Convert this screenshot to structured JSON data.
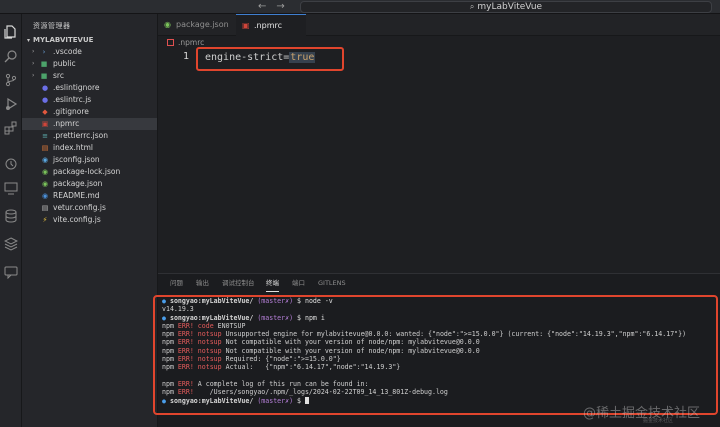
{
  "titlebar": {
    "back": "←",
    "forward": "→",
    "search_text": "myLabViteVue"
  },
  "activity": [
    "files-icon",
    "search-icon",
    "source-control-icon",
    "run-debug-icon",
    "extensions-icon",
    "git-history-icon",
    "remote-icon",
    "database-icon",
    "layers-icon",
    "chat-icon"
  ],
  "sidebar": {
    "title": "资源管理器",
    "project": "MYLABVITEVUE",
    "items": [
      {
        "label": ".vscode",
        "folder": true,
        "icon": "›",
        "color": "#6aa0d8"
      },
      {
        "label": "public",
        "folder": true,
        "icon": "■",
        "color": "#4ca36a"
      },
      {
        "label": "src",
        "folder": true,
        "icon": "■",
        "color": "#4ca36a"
      },
      {
        "label": ".eslintignore",
        "folder": false,
        "icon": "●",
        "color": "#6b6fe6"
      },
      {
        "label": ".eslintrc.js",
        "folder": false,
        "icon": "●",
        "color": "#6b6fe6"
      },
      {
        "label": ".gitignore",
        "folder": false,
        "icon": "◆",
        "color": "#e2583e"
      },
      {
        "label": ".npmrc",
        "folder": false,
        "icon": "▣",
        "color": "#d0453a",
        "active": true
      },
      {
        "label": ".prettierrc.json",
        "folder": false,
        "icon": "≡",
        "color": "#5fb3b3"
      },
      {
        "label": "index.html",
        "folder": false,
        "icon": "▤",
        "color": "#e07a3a"
      },
      {
        "label": "jsconfig.json",
        "folder": false,
        "icon": "◉",
        "color": "#5aa7e0"
      },
      {
        "label": "package-lock.json",
        "folder": false,
        "icon": "◉",
        "color": "#7ac25a"
      },
      {
        "label": "package.json",
        "folder": false,
        "icon": "◉",
        "color": "#7ac25a"
      },
      {
        "label": "README.md",
        "folder": false,
        "icon": "◉",
        "color": "#4a8fd8"
      },
      {
        "label": "vetur.config.js",
        "folder": false,
        "icon": "▤",
        "color": "#bdbdbd"
      },
      {
        "label": "vite.config.js",
        "folder": false,
        "icon": "⚡",
        "color": "#e8c23e"
      }
    ]
  },
  "tabs": [
    {
      "label": "package.json",
      "icon": "◉",
      "color": "#7ac25a",
      "active": false
    },
    {
      "label": ".npmrc",
      "icon": "▣",
      "color": "#d0453a",
      "active": true
    }
  ],
  "breadcrumb": ".npmrc",
  "editor": {
    "line_number": "1",
    "key": "engine-strict=",
    "value": "true"
  },
  "panel": {
    "tabs": [
      "问题",
      "输出",
      "调试控制台",
      "终端",
      "端口",
      "GITLENS"
    ],
    "active_tab": "终端"
  },
  "terminal": {
    "prompt_user": "songyao:myLabViteVue/",
    "branch": "(master✗)",
    "cmd1": "$ node -v",
    "out1": "v14.19.3",
    "cmd2": "$ npm i",
    "errors": [
      {
        "tag": "code",
        "msg": "EN0TSUP"
      },
      {
        "tag": "notsup",
        "msg": "Unsupported engine for mylabvitevue@0.0.0: wanted: {\"node\":\">=15.0.0\"} (current: {\"node\":\"14.19.3\",\"npm\":\"6.14.17\"})"
      },
      {
        "tag": "notsup",
        "msg": "Not compatible with your version of node/npm: mylabvitevue@0.0.0"
      },
      {
        "tag": "notsup",
        "msg": "Not compatible with your version of node/npm: mylabvitevue@0.0.0"
      },
      {
        "tag": "notsup",
        "msg": "Required: {\"node\":\">=15.0.0\"}"
      },
      {
        "tag": "notsup",
        "msg": "Actual:   {\"npm\":\"6.14.17\",\"node\":\"14.19.3\"}"
      }
    ],
    "log1": "A complete log of this run can be found in:",
    "log2": "    /Users/songyao/.npm/_logs/2024-02-22T09_14_13_801Z-debug.log",
    "npm_label": "npm",
    "err_label": "ERR!",
    "dollar": "$"
  },
  "watermark": {
    "main": "@稀土掘金技术社区",
    "small": "掘金技术社区"
  }
}
